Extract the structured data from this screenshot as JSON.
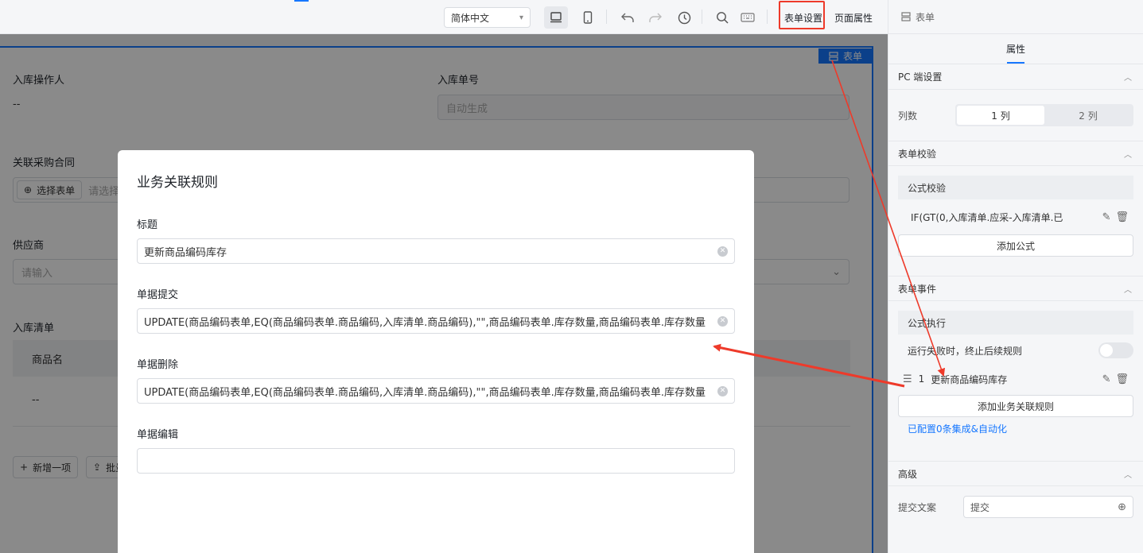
{
  "toolbar": {
    "language": "简体中文",
    "form_settings": "表单设置",
    "page_props": "页面属性"
  },
  "right_panel": {
    "header": "表单",
    "tab": "属性",
    "pc_section": "PC 端设置",
    "columns_label": "列数",
    "col1": "1 列",
    "col2": "2 列",
    "validation_section": "表单校验",
    "formula_check_title": "公式校验",
    "formula_item": "IF(GT(0,入库清单.应采-入库清单.已",
    "add_formula": "添加公式",
    "events_section": "表单事件",
    "formula_exec_title": "公式执行",
    "fail_stop_label": "运行失败时，终止后续规则",
    "rule_item_index": "1",
    "rule_item_name": "更新商品编码库存",
    "add_rule": "添加业务关联规则",
    "integration_link": "已配置0条集成&自动化",
    "advanced_section": "高级",
    "submit_text_label": "提交文案",
    "submit_text_value": "提交"
  },
  "canvas": {
    "form_tag": "表单",
    "field_operator": "入库操作人",
    "field_operator_value": "--",
    "field_order_no": "入库单号",
    "field_order_no_placeholder": "自动生成",
    "field_contract": "关联采购合同",
    "select_form_btn": "选择表单",
    "select_placeholder": "请选择",
    "field_supplier": "供应商",
    "supplier_placeholder": "请输入",
    "field_list": "入库清单",
    "col_product": "商品名",
    "row_value": "--",
    "add_item": "新增一项",
    "batch": "批量"
  },
  "modal": {
    "title": "业务关联规则",
    "label_title": "标题",
    "title_value": "更新商品编码库存",
    "label_submit": "单据提交",
    "submit_formula": "UPDATE(商品编码表单,EQ(商品编码表单.商品编码,入库清单.商品编码),\"\",商品编码表单.库存数量,商品编码表单.库存数量",
    "label_delete": "单据删除",
    "delete_formula": "UPDATE(商品编码表单,EQ(商品编码表单.商品编码,入库清单.商品编码),\"\",商品编码表单.库存数量,商品编码表单.库存数量",
    "label_edit": "单据编辑",
    "edit_formula": ""
  },
  "colors": {
    "accent": "#1677ff",
    "annotation_red": "#ee3a2a"
  },
  "icons": [
    "desktop-icon",
    "mobile-icon",
    "undo-icon",
    "redo-icon",
    "history-icon",
    "search-icon",
    "keyboard-icon",
    "form-icon",
    "edit-icon",
    "delete-icon",
    "drag-handle-icon",
    "globe-icon",
    "chevron-up-icon",
    "clear-icon",
    "plus-circle-icon",
    "upload-icon"
  ]
}
